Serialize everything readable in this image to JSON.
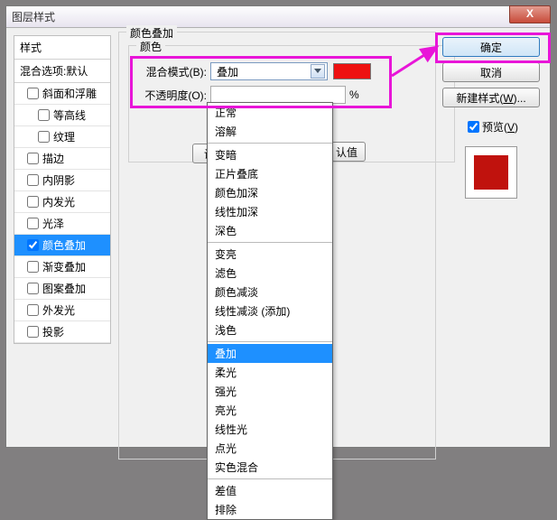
{
  "window": {
    "title": "图层样式",
    "close": "X"
  },
  "sidebar": {
    "heading": "样式",
    "sub": "混合选项:默认",
    "items": [
      {
        "label": "斜面和浮雕",
        "checked": false,
        "level": 1
      },
      {
        "label": "等高线",
        "checked": false,
        "level": 2
      },
      {
        "label": "纹理",
        "checked": false,
        "level": 2
      },
      {
        "label": "描边",
        "checked": false,
        "level": 1
      },
      {
        "label": "内阴影",
        "checked": false,
        "level": 1
      },
      {
        "label": "内发光",
        "checked": false,
        "level": 1
      },
      {
        "label": "光泽",
        "checked": false,
        "level": 1
      },
      {
        "label": "颜色叠加",
        "checked": true,
        "level": 1,
        "selected": true
      },
      {
        "label": "渐变叠加",
        "checked": false,
        "level": 1
      },
      {
        "label": "图案叠加",
        "checked": false,
        "level": 1
      },
      {
        "label": "外发光",
        "checked": false,
        "level": 1
      },
      {
        "label": "投影",
        "checked": false,
        "level": 1
      }
    ]
  },
  "group": {
    "title": "颜色叠加",
    "inner_title": "颜色",
    "blend_label": "混合模式(B):",
    "blend_value": "叠加",
    "opacity_label": "不透明度(O):",
    "opacity_unit": "%",
    "color_swatch": "#ee1111",
    "btn_default": "设置为默认值",
    "btn_reset": "复位为默认值",
    "btn_default_trunc": "设置",
    "btn_reset_trunc": "认值"
  },
  "blendModes": {
    "groups": [
      [
        "正常",
        "溶解"
      ],
      [
        "变暗",
        "正片叠底",
        "颜色加深",
        "线性加深",
        "深色"
      ],
      [
        "变亮",
        "滤色",
        "颜色减淡",
        "线性减淡 (添加)",
        "浅色"
      ],
      [
        "叠加",
        "柔光",
        "强光",
        "亮光",
        "线性光",
        "点光",
        "实色混合"
      ],
      [
        "差值",
        "排除"
      ]
    ],
    "selected": "叠加"
  },
  "right": {
    "ok": "确定",
    "cancel": "取消",
    "newstyle": "新建样式(W)...",
    "preview": "预览(V)",
    "preview_color": "#c0120d"
  }
}
